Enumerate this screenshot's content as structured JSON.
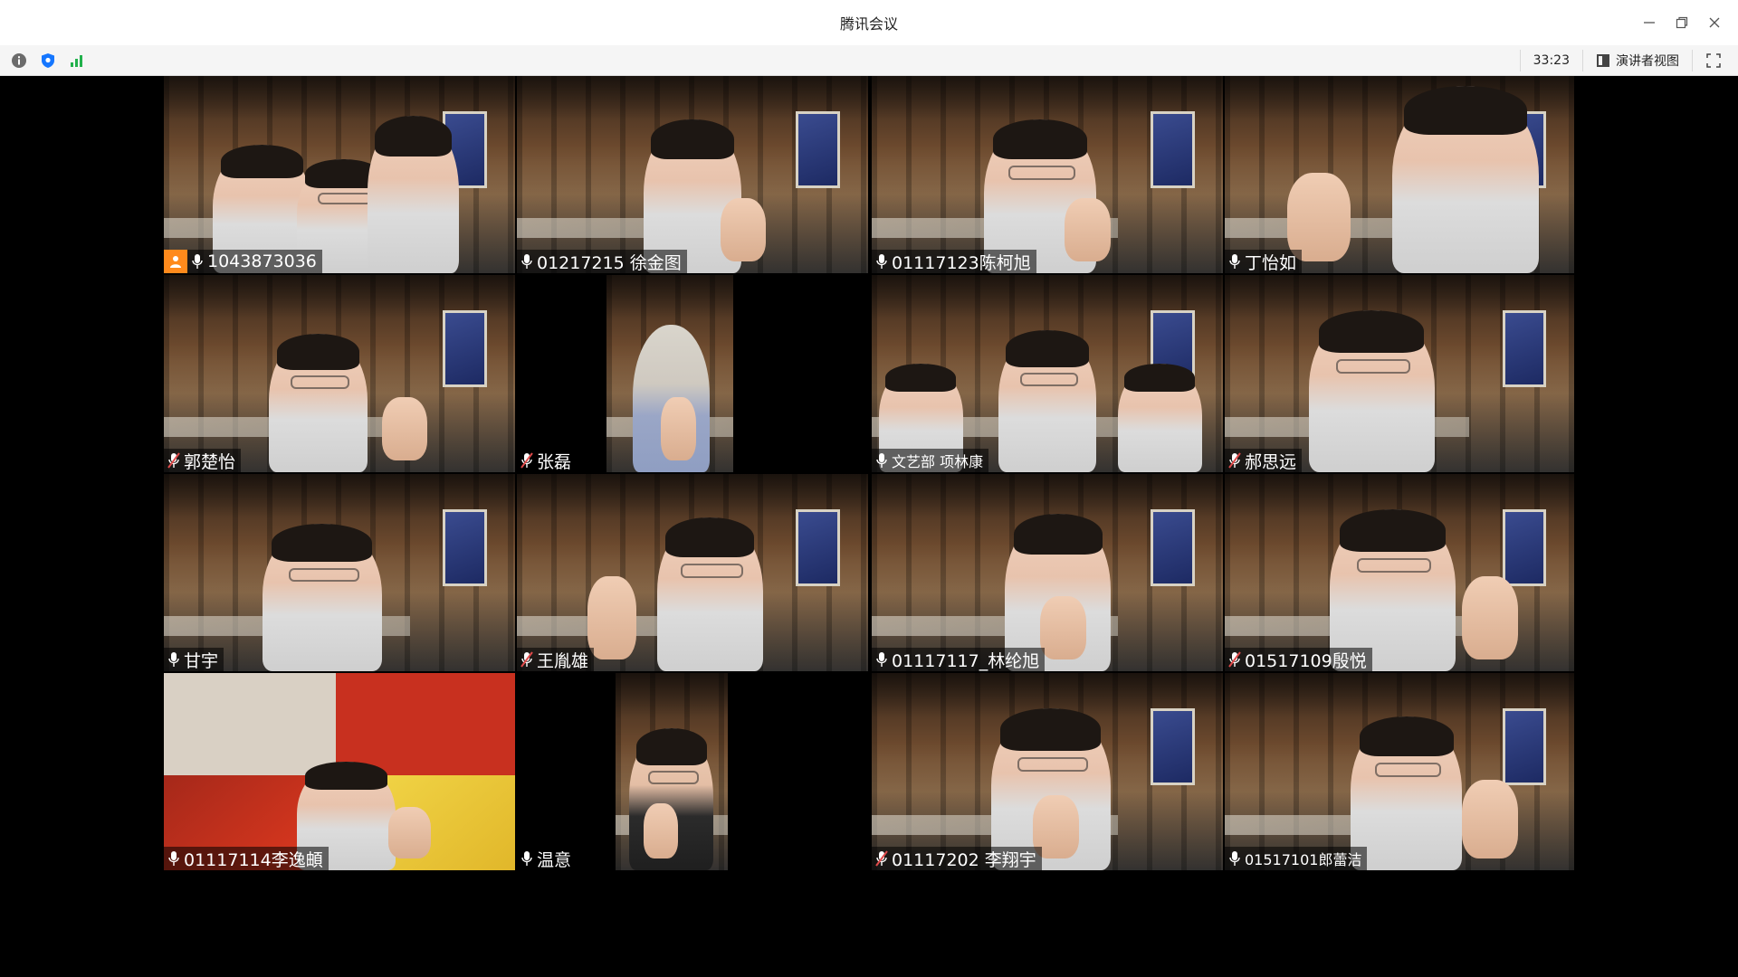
{
  "window": {
    "title": "腾讯会议",
    "controls": {
      "minimize_icon": "minimize-icon",
      "restore_icon": "restore-icon",
      "close_icon": "close-icon"
    }
  },
  "toolbar": {
    "left_icons": [
      "info-icon",
      "shield-icon",
      "network-signal-icon"
    ],
    "timer": "33:23",
    "view_button_label": "演讲者视图",
    "fullscreen_icon": "fullscreen-icon"
  },
  "colors": {
    "active_speaker_border": "#2fc66a",
    "host_badge": "#ff8a1c",
    "muted_icon": "#e04b4b",
    "shield": "#1677ff",
    "signal": "#22b14c"
  },
  "participants": [
    {
      "name": "1043873036",
      "mic": "on",
      "host": true
    },
    {
      "name": "01217215 徐金图",
      "mic": "on",
      "active": true
    },
    {
      "name": "01117123陈柯旭",
      "mic": "on"
    },
    {
      "name": "丁怡如",
      "mic": "on"
    },
    {
      "name": "郭楚怡",
      "mic": "muted"
    },
    {
      "name": "张磊",
      "mic": "muted"
    },
    {
      "name": "文艺部 项林康",
      "mic": "on"
    },
    {
      "name": "郝思远",
      "mic": "muted"
    },
    {
      "name": "甘宇",
      "mic": "on"
    },
    {
      "name": "王胤雄",
      "mic": "muted"
    },
    {
      "name": "01117117_林纶旭",
      "mic": "on"
    },
    {
      "name": "01517109殷悦",
      "mic": "muted"
    },
    {
      "name": "01117114李逸頔",
      "mic": "on",
      "active": true
    },
    {
      "name": "温意",
      "mic": "on"
    },
    {
      "name": "01117202 李翔宇",
      "mic": "muted"
    },
    {
      "name": "01517101郎蕾洁",
      "mic": "on"
    }
  ]
}
